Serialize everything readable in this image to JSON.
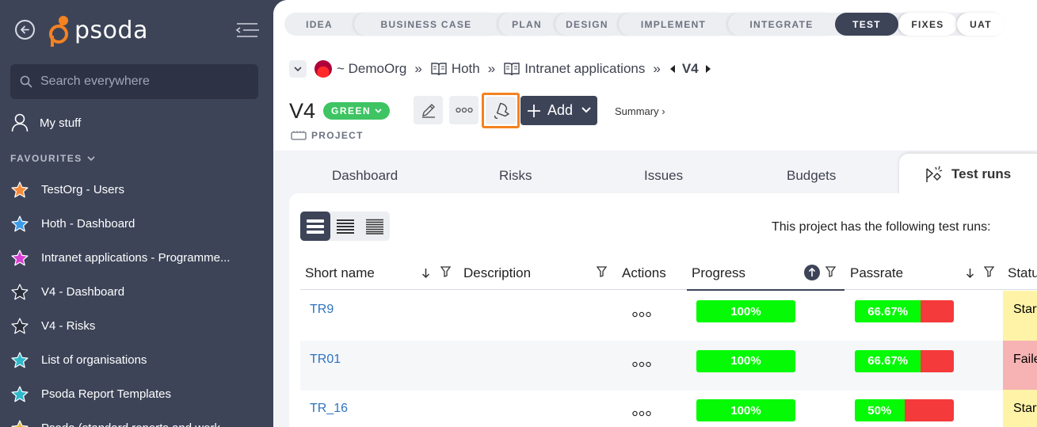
{
  "sidebar": {
    "logo_text": "psoda",
    "search_placeholder": "Search everywhere",
    "my_stuff": "My stuff",
    "favourites_heading": "FAVOURITES",
    "favourites": [
      {
        "label": "TestOrg - Users",
        "star_color": "#f58b3a"
      },
      {
        "label": "Hoth - Dashboard",
        "star_color": "#3b9be8"
      },
      {
        "label": "Intranet applications - Programme...",
        "star_color": "#d83fd3"
      },
      {
        "label": "V4 - Dashboard",
        "star_color": "#2a2e3a"
      },
      {
        "label": "V4 - Risks",
        "star_color": "#2a2e3a"
      },
      {
        "label": "List of organisations",
        "star_color": "#2fb8c9"
      },
      {
        "label": "Psoda Report Templates",
        "star_color": "#2fb8c9"
      },
      {
        "label": "Psoda (standard reports and work...",
        "star_color": "#e2b93b"
      }
    ]
  },
  "phases": [
    "IDEA",
    "BUSINESS CASE",
    "PLAN",
    "DESIGN",
    "IMPLEMENT",
    "INTEGRATE",
    "TEST",
    "FIXES",
    "UAT"
  ],
  "active_phase": "TEST",
  "breadcrumb": {
    "org": "~ DemoOrg",
    "sep": "»",
    "items": [
      "Hoth",
      "Intranet applications"
    ],
    "current": "V4"
  },
  "project": {
    "title": "V4",
    "status": "GREEN",
    "type": "PROJECT",
    "add_label": "Add",
    "summary_label": "Summary ›"
  },
  "tabs": [
    "Dashboard",
    "Risks",
    "Issues",
    "Budgets",
    "Test runs"
  ],
  "active_tab": "Test runs",
  "table": {
    "intro": "This project has the following test runs:",
    "columns": {
      "short_name": "Short name",
      "description": "Description",
      "actions": "Actions",
      "progress": "Progress",
      "passrate": "Passrate",
      "status": "Status"
    },
    "rows": [
      {
        "name": "TR9",
        "progress": "100%",
        "progress_value": 100,
        "passrate": "66.67%",
        "passrate_value": 66.67,
        "status": "Started",
        "status_color": "#fff3a8"
      },
      {
        "name": "TR01",
        "progress": "100%",
        "progress_value": 100,
        "passrate": "66.67%",
        "passrate_value": 66.67,
        "status": "Failed",
        "status_color": "#f7b3b3"
      },
      {
        "name": "TR_16",
        "progress": "100%",
        "progress_value": 100,
        "passrate": "50%",
        "passrate_value": 50,
        "status": "Started",
        "status_color": "#fff3a8"
      }
    ]
  },
  "colors": {
    "sidebar_bg": "#3d4458",
    "accent_orange": "#f58220",
    "status_green": "#3ec463",
    "bar_green": "#05fa05",
    "bar_red": "#f43a3a",
    "link_blue": "#2f73c0"
  }
}
